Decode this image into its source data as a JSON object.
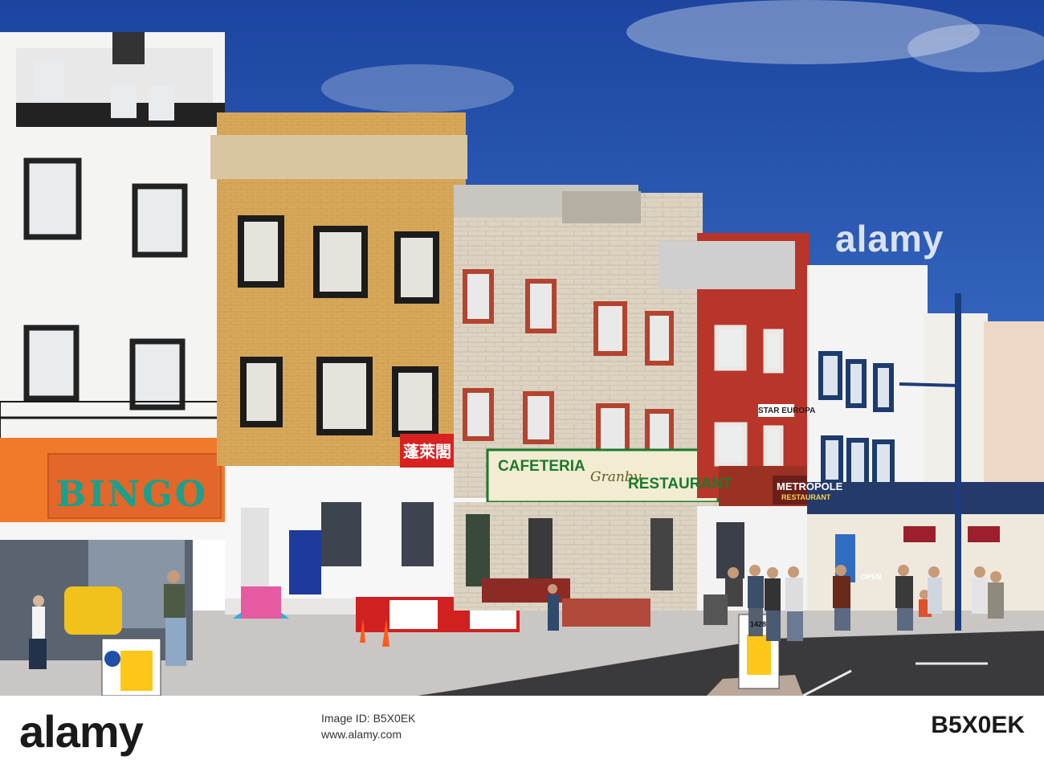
{
  "photo": {
    "signs": {
      "bingo": "BINGO",
      "chinese": "蓬萊閣",
      "cafeteria": "CAFETERIA",
      "granby": "Granby",
      "restaurant": "RESTAURANT",
      "star_europa": "STAR EUROPA",
      "metropole": "METROPOLE",
      "metropole_sub": "RESTAURANT",
      "open": "OPEN",
      "bollard_number": "1428"
    },
    "watermark": "alamy"
  },
  "banner": {
    "brand": "alamy",
    "image_id_label": "Image ID: B5X0EK",
    "site_url": "www.alamy.com",
    "stock_id": "B5X0EK"
  },
  "colors": {
    "sky": "#1f4fa8",
    "bingo_orange": "#f07a2a",
    "cafeteria_green": "#1c7a2c",
    "red_building": "#b8352a",
    "road": "#3a3a3c"
  }
}
